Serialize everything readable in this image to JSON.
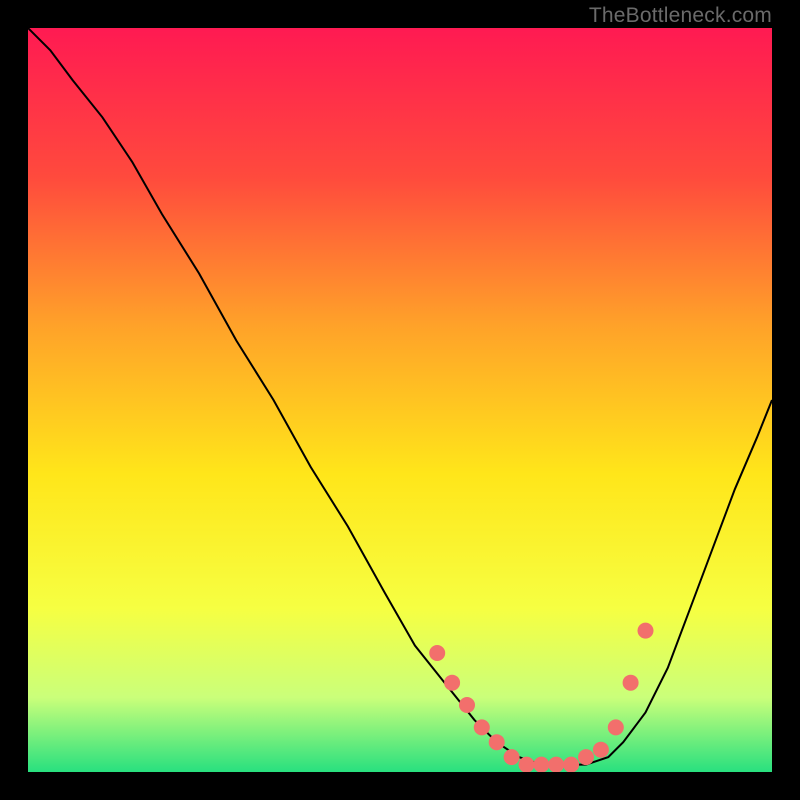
{
  "watermark": {
    "text": "TheBottleneck.com"
  },
  "chart_data": {
    "type": "line",
    "title": "",
    "xlabel": "",
    "ylabel": "",
    "xlim": [
      0,
      100
    ],
    "ylim": [
      0,
      100
    ],
    "grid": false,
    "legend": false,
    "background_gradient": {
      "stops": [
        {
          "pos": 0.0,
          "color": "#ff1a52"
        },
        {
          "pos": 0.2,
          "color": "#ff4a3d"
        },
        {
          "pos": 0.4,
          "color": "#ffa229"
        },
        {
          "pos": 0.6,
          "color": "#ffe61a"
        },
        {
          "pos": 0.78,
          "color": "#f6ff42"
        },
        {
          "pos": 0.9,
          "color": "#caff7a"
        },
        {
          "pos": 1.0,
          "color": "#28e07f"
        }
      ]
    },
    "series": [
      {
        "name": "curve",
        "color": "#000000",
        "x": [
          0,
          3,
          6,
          10,
          14,
          18,
          23,
          28,
          33,
          38,
          43,
          48,
          52,
          56,
          60,
          63,
          66,
          69,
          72,
          75,
          78,
          80,
          83,
          86,
          89,
          92,
          95,
          98,
          100
        ],
        "y": [
          100,
          97,
          93,
          88,
          82,
          75,
          67,
          58,
          50,
          41,
          33,
          24,
          17,
          12,
          7,
          4,
          2,
          1,
          1,
          1,
          2,
          4,
          8,
          14,
          22,
          30,
          38,
          45,
          50
        ]
      },
      {
        "name": "points",
        "type": "scatter",
        "color": "#f26f6c",
        "x": [
          55,
          57,
          59,
          61,
          63,
          65,
          67,
          69,
          71,
          73,
          75,
          77,
          79,
          81,
          83
        ],
        "y": [
          16,
          12,
          9,
          6,
          4,
          2,
          1,
          1,
          1,
          1,
          2,
          3,
          6,
          12,
          19
        ]
      }
    ]
  }
}
